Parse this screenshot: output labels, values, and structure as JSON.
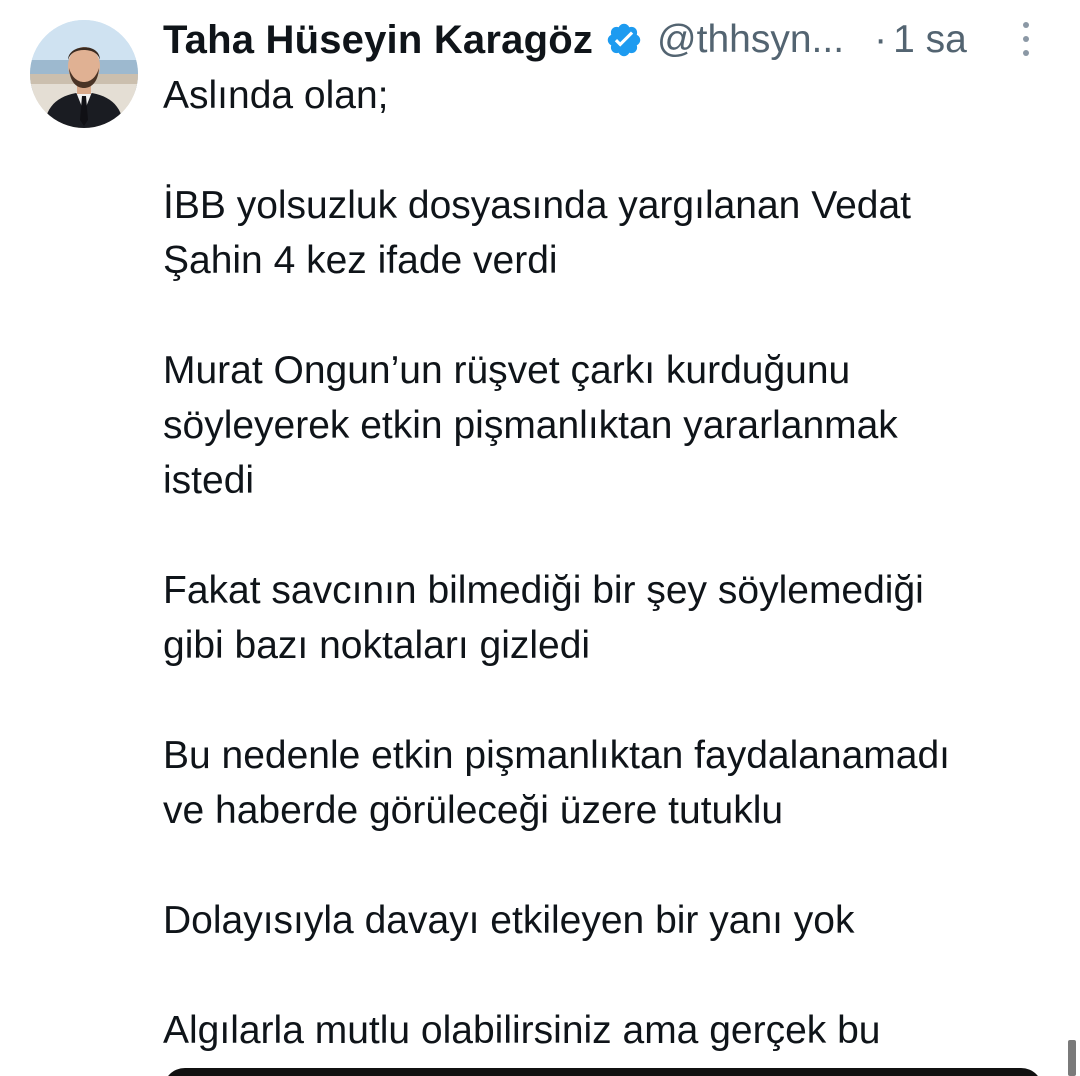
{
  "author": {
    "name": "Taha Hüseyin Karagöz",
    "handle": "@thhsyn...",
    "verified_color": "#1d9bf0"
  },
  "meta": {
    "separator": "·",
    "time": "1 sa"
  },
  "icons": {
    "verified": "verified-badge-icon",
    "more": "more-options-icon"
  },
  "tweet": {
    "paragraphs": [
      "Aslında olan;",
      "İBB yolsuzluk dosyasında yargılanan Vedat\nŞahin 4 kez ifade verdi",
      "Murat Ongun’un rüşvet çarkı kurduğunu\nsöyleyerek etkin pişmanlıktan yararlanmak\nistedi",
      "Fakat savcının bilmediği bir şey söylemediği\ngibi bazı noktaları gizledi",
      "Bu nedenle etkin pişmanlıktan faydalanamadı\nve haberde görüleceği üzere tutuklu",
      "Dolayısıyla davayı etkileyen bir yanı yok",
      "Algılarla mutlu olabilirsiniz ama gerçek bu"
    ]
  }
}
